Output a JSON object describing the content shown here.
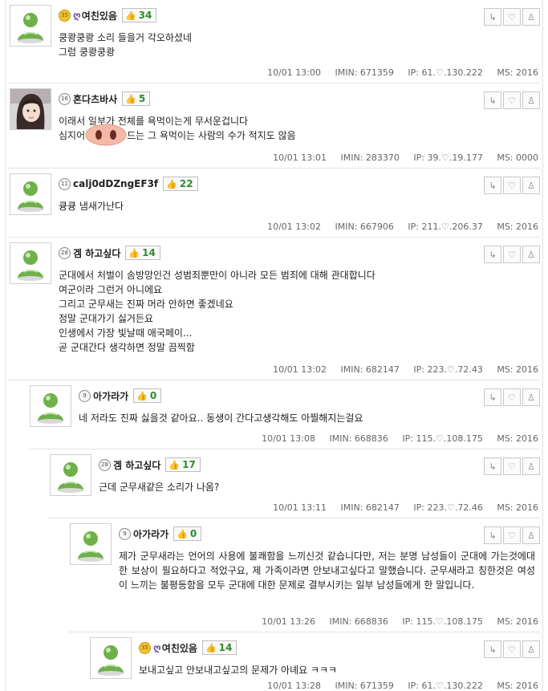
{
  "comments": [
    {
      "level": "35",
      "gold": true,
      "ring": "ღ",
      "nick": "여친있음",
      "likes": "34",
      "avatar": "default",
      "lines": [
        "쿵쾅쿵쾅 소리 들을거 각오하셨네",
        "그럼 쿵쾅쿵쾅"
      ],
      "time": "10/01 13:00",
      "imin": "IMIN: 671359",
      "ip": "IP: 61.♡.130.222",
      "ms": "MS: 2016"
    },
    {
      "level": "16",
      "gold": false,
      "ring": "",
      "nick": "혼다츠바사",
      "likes": "5",
      "avatar": "photo",
      "lines": [
        "이래서 일부가 전체를 욕먹이는게 무서운겁니다",
        "심지어"
      ],
      "line2_after": "드는 그 욕먹이는 사람의 수가 적지도 않음",
      "time": "10/01 13:01",
      "imin": "IMIN: 283370",
      "ip": "IP: 39.♡.19.177",
      "ms": "MS: 0000"
    },
    {
      "level": "11",
      "gold": false,
      "ring": "",
      "nick": "calj0dDZngEF3f",
      "likes": "22",
      "avatar": "default",
      "lines": [
        "큥큥 냄새가난다"
      ],
      "time": "10/01 13:02",
      "imin": "IMIN: 667906",
      "ip": "IP: 211.♡.206.37",
      "ms": "MS: 2016"
    },
    {
      "level": "28",
      "gold": false,
      "ring": "",
      "nick": "겜 하고싶다",
      "likes": "14",
      "avatar": "default",
      "lines": [
        "군대에서 처벌이 솜방망인건 성범죄뿐만이 아니라 모든 범죄에 대해 관대합니다",
        "여군이라 그런거 아니에요",
        "그리고 군무새는 진짜 머라 안하면 좋겠네요",
        "정말 군대가기 싫거든요",
        "인생에서 가장 빛날때 애국페이...",
        "곧 군대간다 생각하면 정말 끔찍함"
      ],
      "time": "10/01 13:02",
      "imin": "IMIN: 682147",
      "ip": "IP: 223.♡.72.43",
      "ms": "MS: 2016"
    },
    {
      "level": "9",
      "gold": false,
      "ring": "",
      "nick": "아가라가",
      "likes": "0",
      "avatar": "default",
      "lines": [
        "네 저라도 진짜 싫을것 같아요.. 동생이 간다고생각해도 아찔해지는걸요"
      ],
      "time": "10/01 13:08",
      "imin": "IMIN: 668836",
      "ip": "IP: 115.♡.108.175",
      "ms": "MS: 2016"
    },
    {
      "level": "28",
      "gold": false,
      "ring": "",
      "nick": "겜 하고싶다",
      "likes": "17",
      "avatar": "default",
      "lines": [
        "근데 군무새같은 소리가 나옴?"
      ],
      "time": "10/01 13:11",
      "imin": "IMIN: 682147",
      "ip": "IP: 223.♡.72.46",
      "ms": "MS: 2016"
    },
    {
      "level": "9",
      "gold": false,
      "ring": "",
      "nick": "아가라가",
      "likes": "0",
      "avatar": "default",
      "lines": [
        "제가 군무새라는 언어의 사용에 불쾌함을 느끼신것 같습니다만, 저는 분명 남성들이 군대에 가는것에대한 보상이 필요하다고 적었구요, 제 가족이라면 안보내고싶다고 말했습니다. 군무새라고 칭한것은 여성이 느끼는 불평등함을 모두 군대에 대한 문제로 결부시키는 일부 남성들에게 한 말입니다."
      ],
      "time": "10/01 13:26",
      "imin": "IMIN: 668836",
      "ip": "IP: 115.♡.108.175",
      "ms": "MS: 2016"
    },
    {
      "level": "35",
      "gold": true,
      "ring": "ღ",
      "nick": "여친있음",
      "likes": "14",
      "avatar": "default",
      "lines": [
        "보내고싶고 안보내고싶고의 문제가 아녜요 ㅋㅋㅋ"
      ],
      "time": "10/01 13:28",
      "imin": "IMIN: 671359",
      "ip": "IP: 61.♡.130.222",
      "ms": "MS: 2016"
    }
  ],
  "colors": {
    "like_green": "#2e8b2e",
    "ring_purple": "#7a4fa8",
    "level_gold": "#f1c232",
    "border": "#e3e3e3"
  },
  "icons": {
    "reply": "reply-arrow-icon",
    "like": "heart-icon",
    "report": "siren-icon",
    "thumb": "thumb-up-icon"
  }
}
